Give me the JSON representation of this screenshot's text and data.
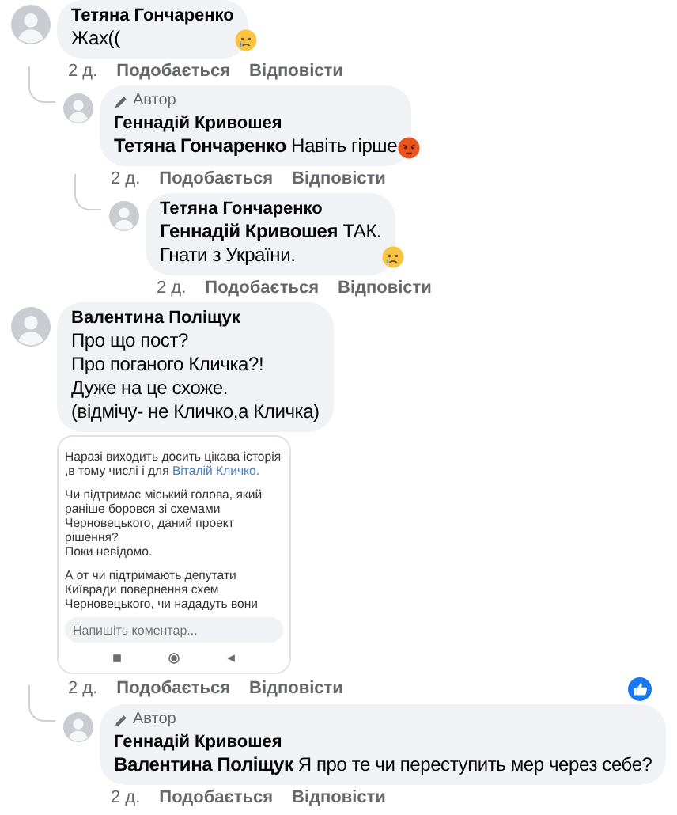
{
  "comments": [
    {
      "author": "Тетяна Гончаренко",
      "text": "Жах((",
      "reaction": {
        "kind": "sad"
      },
      "time": "2 д.",
      "like": "Подобається",
      "reply": "Відповісти",
      "children": [
        {
          "badge": "Автор",
          "author": "Геннадій Кривошея",
          "mention": "Тетяна Гончаренко",
          "text": "Навіть гірше",
          "reaction": {
            "kind": "angry"
          },
          "time": "2 д.",
          "like": "Подобається",
          "reply": "Відповісти",
          "children": [
            {
              "author": "Тетяна Гончаренко",
              "mention": "Геннадій Кривошея",
              "text": "ТАК.\nГнати з України.",
              "reaction": {
                "kind": "sad"
              },
              "time": "2 д.",
              "like": "Подобається",
              "reply": "Відповісти"
            }
          ]
        }
      ]
    },
    {
      "author": "Валентина Поліщук",
      "text": "Про що пост?\nПро поганого Кличка?!\nДуже на це схоже.\n(відмічу- не Кличко,а Кличка)",
      "attachment": {
        "kind": "screenshot",
        "paragraphs": [
          {
            "text": "Наразі виходить досить цікава історія ,в тому числі і для ",
            "link": "Віталій Кличко."
          },
          {
            "text": "Чи підтримає міський голова, який раніше боровся зі схемами Черновецького, даний проект рішення?\nПоки невідомо."
          },
          {
            "text": "А от чи підтримають депутати Київради повернення схем Черновецького, чи нададуть вони"
          }
        ],
        "comment_field": {
          "placeholder": "Напишіть коментар..."
        }
      },
      "reaction_summary": {
        "kind": "like"
      },
      "time": "2 д.",
      "like": "Подобається",
      "reply": "Відповісти",
      "children": [
        {
          "badge": "Автор",
          "author": "Геннадій Кривошея",
          "mention": "Валентина Поліщук",
          "text": "Я про те чи переступить мер через себе?",
          "time": "2 д.",
          "like": "Подобається",
          "reply": "Відповісти"
        }
      ]
    }
  ]
}
